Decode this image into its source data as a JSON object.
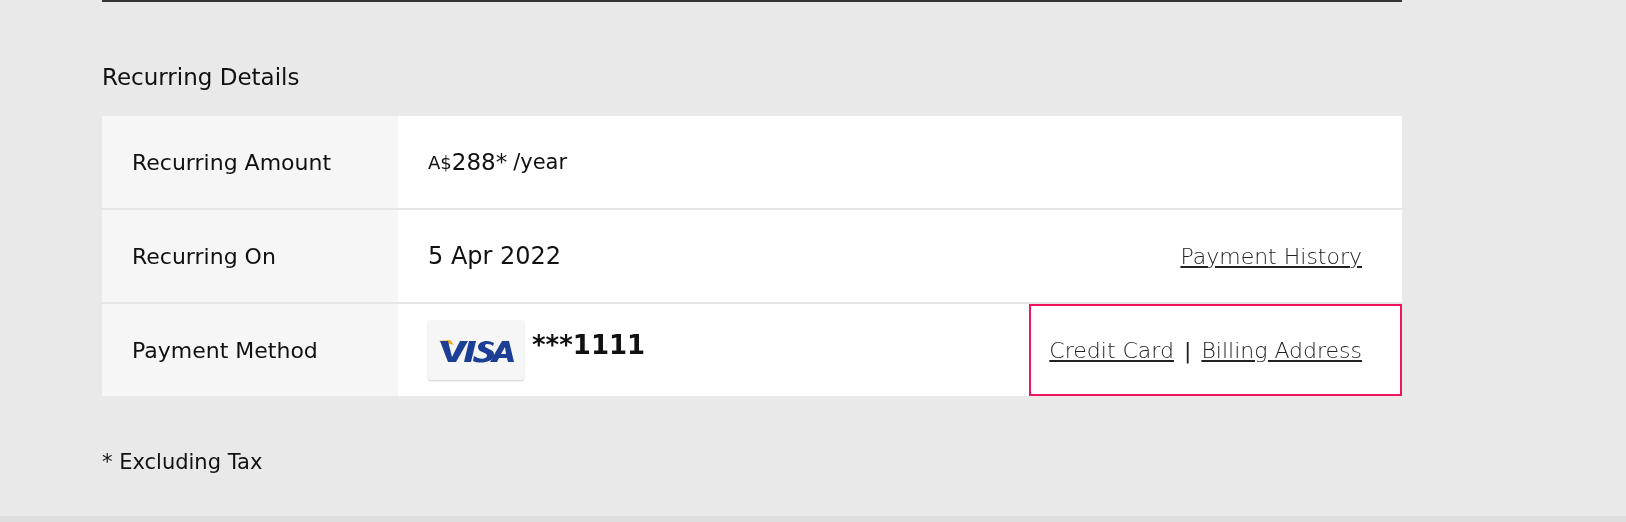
{
  "section_title": "Recurring Details",
  "rows": [
    {
      "kind": "amount",
      "label": "Recurring Amount",
      "currency": "A$",
      "amount": "288*",
      "period": "/year"
    },
    {
      "kind": "date",
      "label": "Recurring On",
      "value": "5 Apr 2022",
      "links": [
        "Payment History"
      ],
      "highlighted": false
    },
    {
      "kind": "card",
      "label": "Payment Method",
      "masked": "***1111",
      "links": [
        "Credit Card",
        "Billing Address"
      ],
      "separator": "|",
      "highlighted": true
    }
  ],
  "footnote": "* Excluding Tax"
}
